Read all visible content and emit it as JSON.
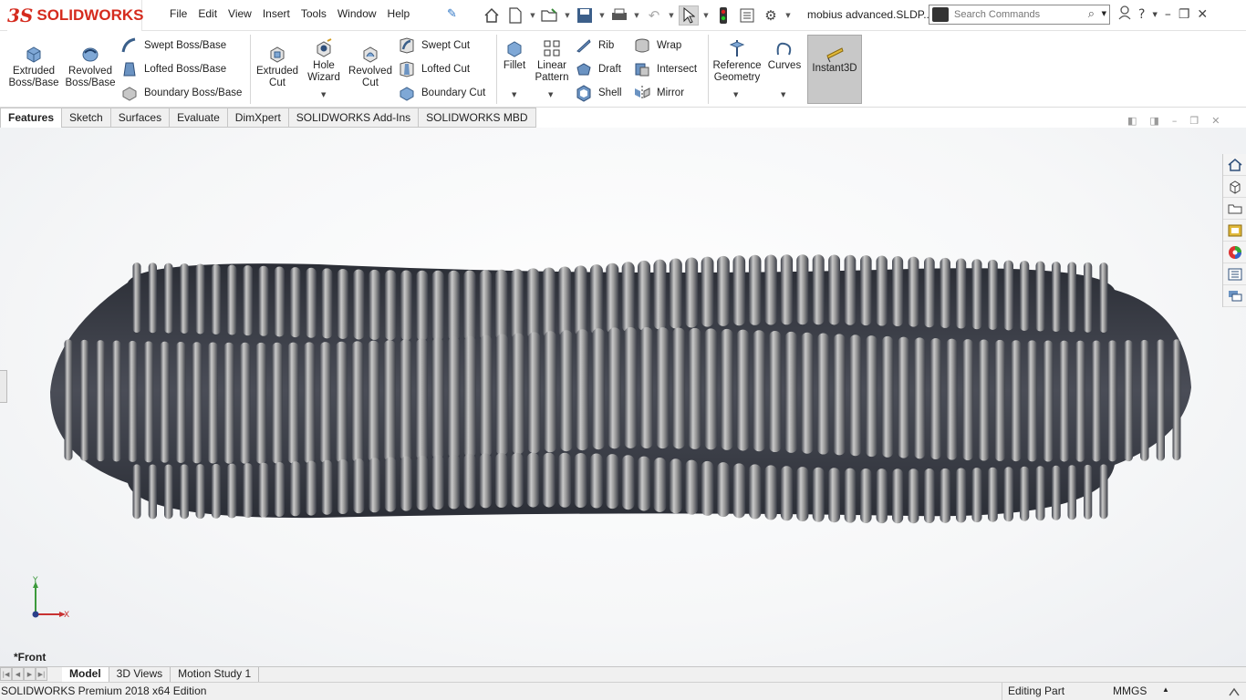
{
  "app": {
    "logo_prefix": "3S",
    "logo_text": "SOLIDWORKS",
    "document_title": "mobius advanced.SLDP..."
  },
  "menu": [
    "File",
    "Edit",
    "View",
    "Insert",
    "Tools",
    "Window",
    "Help"
  ],
  "search": {
    "placeholder": "Search Commands"
  },
  "command_manager": {
    "extruded_boss": "Extruded\nBoss/Base",
    "revolved_boss": "Revolved\nBoss/Base",
    "swept_boss": "Swept Boss/Base",
    "lofted_boss": "Lofted Boss/Base",
    "boundary_boss": "Boundary Boss/Base",
    "extruded_cut": "Extruded\nCut",
    "hole_wizard": "Hole\nWizard",
    "revolved_cut": "Revolved\nCut",
    "swept_cut": "Swept Cut",
    "lofted_cut": "Lofted Cut",
    "boundary_cut": "Boundary Cut",
    "fillet": "Fillet",
    "linear_pattern": "Linear\nPattern",
    "rib": "Rib",
    "draft": "Draft",
    "shell": "Shell",
    "wrap": "Wrap",
    "intersect": "Intersect",
    "mirror": "Mirror",
    "reference_geometry": "Reference\nGeometry",
    "curves": "Curves",
    "instant3d": "Instant3D"
  },
  "tabs": [
    "Features",
    "Sketch",
    "Surfaces",
    "Evaluate",
    "DimXpert",
    "SOLIDWORKS Add-Ins",
    "SOLIDWORKS MBD"
  ],
  "viewport": {
    "view_name": "*Front",
    "axis_y": "Y",
    "axis_x": "X"
  },
  "bottom_tabs": [
    "Model",
    "3D Views",
    "Motion Study 1"
  ],
  "status": {
    "edition": "SOLIDWORKS Premium 2018 x64 Edition",
    "mode": "Editing Part",
    "units": "MMGS"
  },
  "colors": {
    "brand": "#d52b1e",
    "accent": "#2a73c4"
  }
}
